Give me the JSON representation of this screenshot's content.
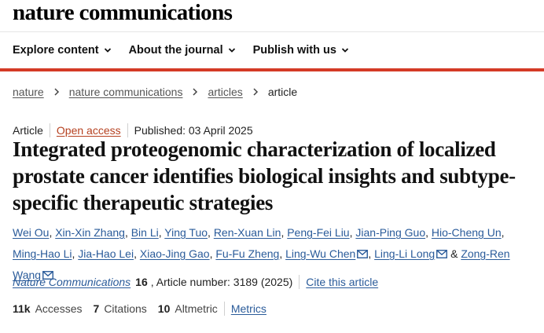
{
  "header": {
    "logo": "nature communications"
  },
  "nav": {
    "items": [
      {
        "label": "Explore content"
      },
      {
        "label": "About the journal"
      },
      {
        "label": "Publish with us"
      }
    ]
  },
  "breadcrumb": [
    "nature",
    "nature communications",
    "articles",
    "article"
  ],
  "article": {
    "type": "Article",
    "access": "Open access",
    "published": "Published: 03 April 2025",
    "title": "Integrated proteogenomic characterization of localized prostate cancer identifies biological insights and subtype-specific therapeutic strategies",
    "authors": [
      "Wei Ou",
      "Xin-Xin Zhang",
      "Bin Li",
      "Ying Tuo",
      "Ren-Xuan Lin",
      "Peng-Fei Liu",
      "Jian-Ping Guo",
      "Hio-Cheng Un",
      "Ming-Hao Li",
      "Jia-Hao Lei",
      "Xiao-Jing Gao",
      "Fu-Fu Zheng",
      "Ling-Wu Chen",
      "Ling-Li Long",
      "Zong-Ren Wang"
    ],
    "and_label": "&",
    "journal": "Nature Communications",
    "volume": "16",
    "article_number": ", Article number: 3189 (2025)",
    "cite_label": "Cite this article"
  },
  "metrics": {
    "accesses_value": "11k",
    "accesses_label": "Accesses",
    "citations_value": "7",
    "citations_label": "Citations",
    "altmetric_value": "10",
    "altmetric_label": "Altmetric",
    "metrics_link": "Metrics"
  },
  "colors": {
    "accent_red": "#d43a26",
    "link_blue": "#2a5b9a",
    "open_access": "#b5401f"
  }
}
